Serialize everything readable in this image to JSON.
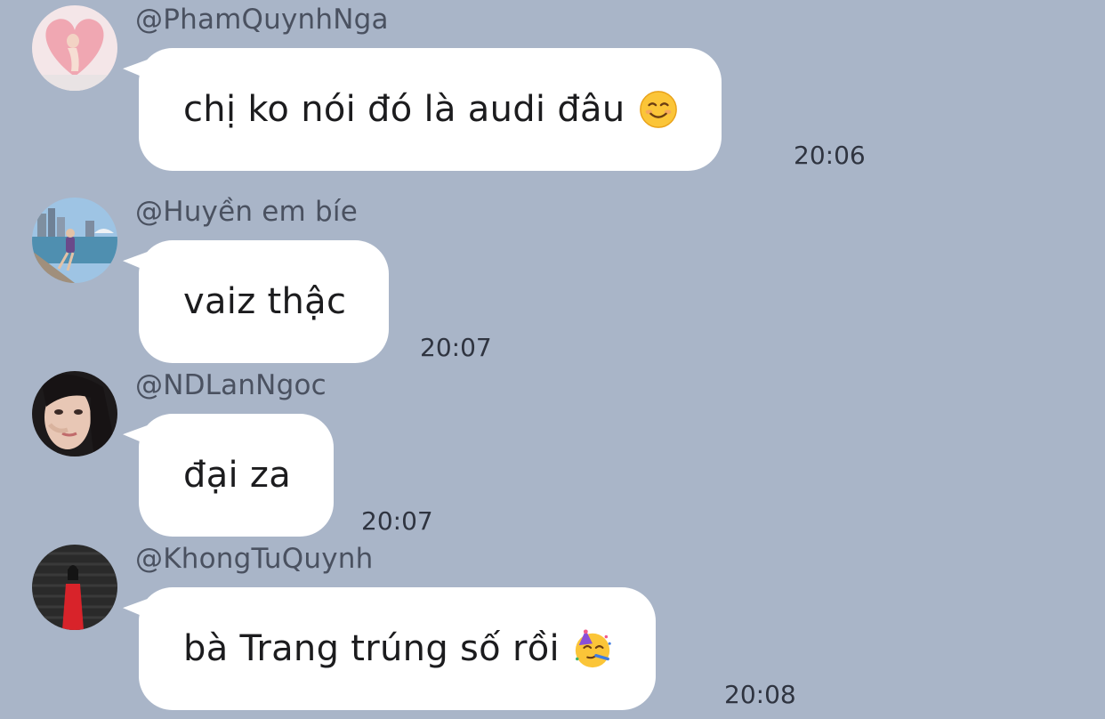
{
  "messages": [
    {
      "sender": "@PhamQuynhNga",
      "text": "chị ko nói đó là audi đâu",
      "emoji": "smiling-face-icon",
      "time": "20:06"
    },
    {
      "sender": "@Huyền em bíe",
      "text": "vaiz thậc",
      "emoji": "",
      "time": "20:07"
    },
    {
      "sender": "@NDLanNgoc",
      "text": "đại za",
      "emoji": "",
      "time": "20:07"
    },
    {
      "sender": "@KhongTuQuynh",
      "text": "bà Trang trúng số rồi",
      "emoji": "partying-face-icon",
      "time": "20:08"
    }
  ],
  "colors": {
    "background": "#a9b5c8",
    "bubble": "#ffffff",
    "sender_text": "#4a5160",
    "time_text": "#2f3440"
  }
}
